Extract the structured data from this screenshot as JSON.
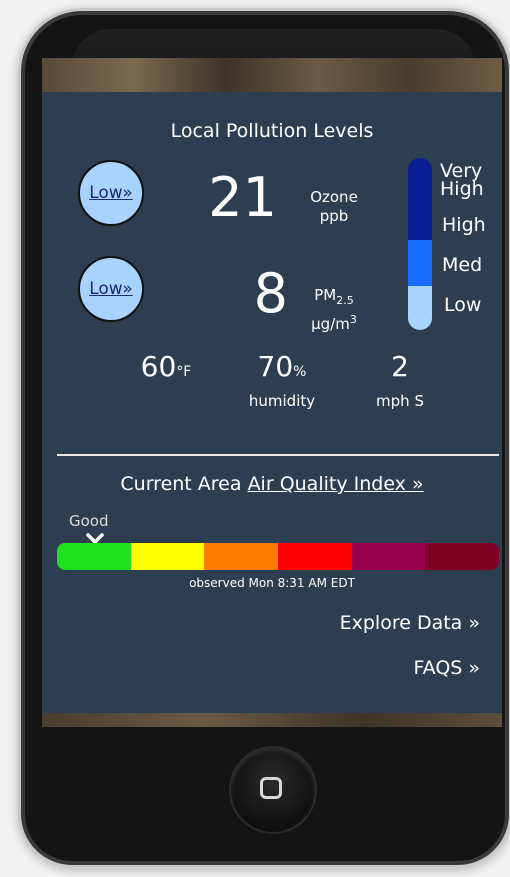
{
  "screen_title": "Local Pollution Levels",
  "pollutants": [
    {
      "level_button": "Low»",
      "value": "21",
      "name": "Ozone",
      "unit": "ppb"
    },
    {
      "level_button": "Low»",
      "value": "8",
      "name_main": "PM",
      "name_sub": "2.5",
      "unit_main": "μg/m",
      "unit_sup": "3"
    }
  ],
  "scale": {
    "labels": [
      "Very",
      "High",
      "High",
      "Med",
      "Low"
    ],
    "colors": {
      "very_high": "#0a1e96",
      "high": "#0a1e96",
      "med": "#1a6cff",
      "low": "#a9d3ff"
    }
  },
  "weather": {
    "temperature": "60",
    "temperature_unit": "°F",
    "humidity": "70",
    "humidity_unit": "%",
    "humidity_label": "humidity",
    "wind": "2",
    "wind_label": "mph S"
  },
  "aqi": {
    "title_prefix": "Current Area",
    "link_text": "Air Quality Index »",
    "current_label": "Good",
    "colors": [
      "#1fe01f",
      "#ffff00",
      "#ff7e00",
      "#ff0000",
      "#99004c",
      "#7e0023"
    ],
    "observed": "observed Mon 8:31 AM EDT"
  },
  "links": {
    "explore": "Explore Data »",
    "faqs": "FAQS »"
  }
}
